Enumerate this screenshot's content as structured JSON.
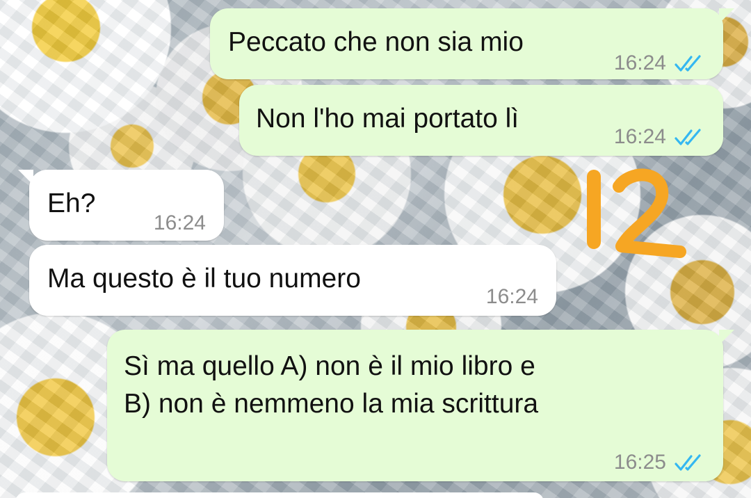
{
  "colors": {
    "outgoing_bubble": "#e5fcd6",
    "incoming_bubble": "#ffffff",
    "read_check": "#34b7f1",
    "overlay_number": "#f6a623"
  },
  "overlay": {
    "text": "12"
  },
  "messages": [
    {
      "direction": "outgoing",
      "text": "Peccato che non sia mio",
      "time": "16:24",
      "status_icon": "double-check-read-icon"
    },
    {
      "direction": "outgoing",
      "text": "Non l'ho mai portato lì",
      "time": "16:24",
      "status_icon": "double-check-read-icon"
    },
    {
      "direction": "incoming",
      "text": "Eh?",
      "time": "16:24"
    },
    {
      "direction": "incoming",
      "text": "Ma questo è il tuo numero",
      "time": "16:24"
    },
    {
      "direction": "outgoing",
      "text_lines": [
        "Sì ma quello A) non è il mio libro e",
        "B) non è nemmeno la mia scrittura"
      ],
      "time": "16:25",
      "status_icon": "double-check-read-icon"
    }
  ]
}
